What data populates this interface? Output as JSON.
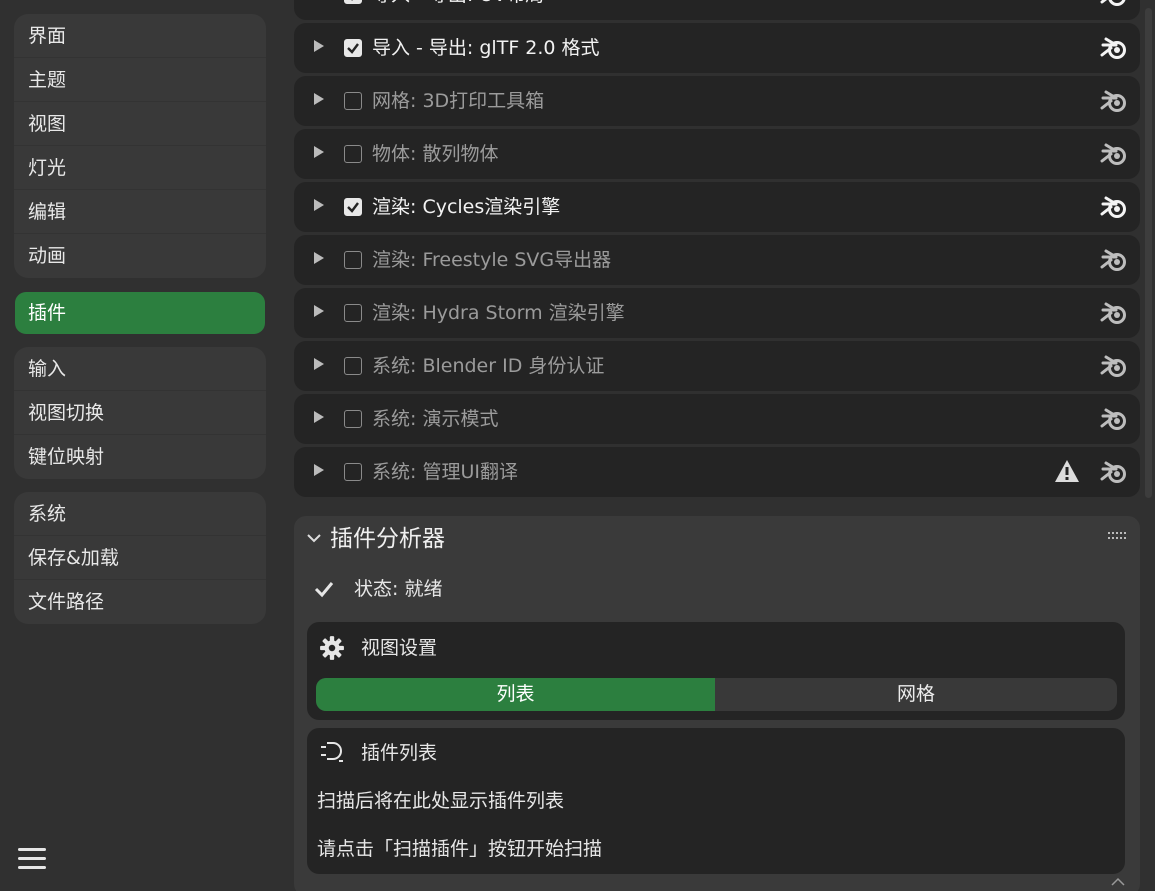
{
  "sidebar": {
    "group1": [
      "界面",
      "主题",
      "视图",
      "灯光",
      "编辑",
      "动画"
    ],
    "active": "插件",
    "group2": [
      "输入",
      "视图切换",
      "键位映射"
    ],
    "group3": [
      "系统",
      "保存&加载",
      "文件路径"
    ]
  },
  "addons": [
    {
      "label": "导入 - 导出: UV布局",
      "enabled": true,
      "warning": false
    },
    {
      "label": "导入 - 导出: glTF 2.0 格式",
      "enabled": true,
      "warning": false
    },
    {
      "label": "网格: 3D打印工具箱",
      "enabled": false,
      "warning": false
    },
    {
      "label": "物体: 散列物体",
      "enabled": false,
      "warning": false
    },
    {
      "label": "渲染: Cycles渲染引擎",
      "enabled": true,
      "warning": false
    },
    {
      "label": "渲染: Freestyle SVG导出器",
      "enabled": false,
      "warning": false
    },
    {
      "label": "渲染: Hydra Storm 渲染引擎",
      "enabled": false,
      "warning": false
    },
    {
      "label": "系统: Blender ID 身份认证",
      "enabled": false,
      "warning": false
    },
    {
      "label": "系统: 演示模式",
      "enabled": false,
      "warning": false
    },
    {
      "label": "系统: 管理UI翻译",
      "enabled": false,
      "warning": true
    }
  ],
  "analyzer": {
    "title": "插件分析器",
    "status": "状态: 就绪",
    "view_settings": {
      "title": "视图设置",
      "options": [
        "列表",
        "网格"
      ],
      "selected": "列表"
    },
    "list": {
      "title": "插件列表",
      "line1": "扫描后将在此处显示插件列表",
      "line2": "请点击「扫描插件」按钮开始扫描"
    }
  },
  "colors": {
    "accent": "#2c7f3f",
    "background": "#303030",
    "row": "#242424",
    "panel": "#3a3a3a"
  }
}
